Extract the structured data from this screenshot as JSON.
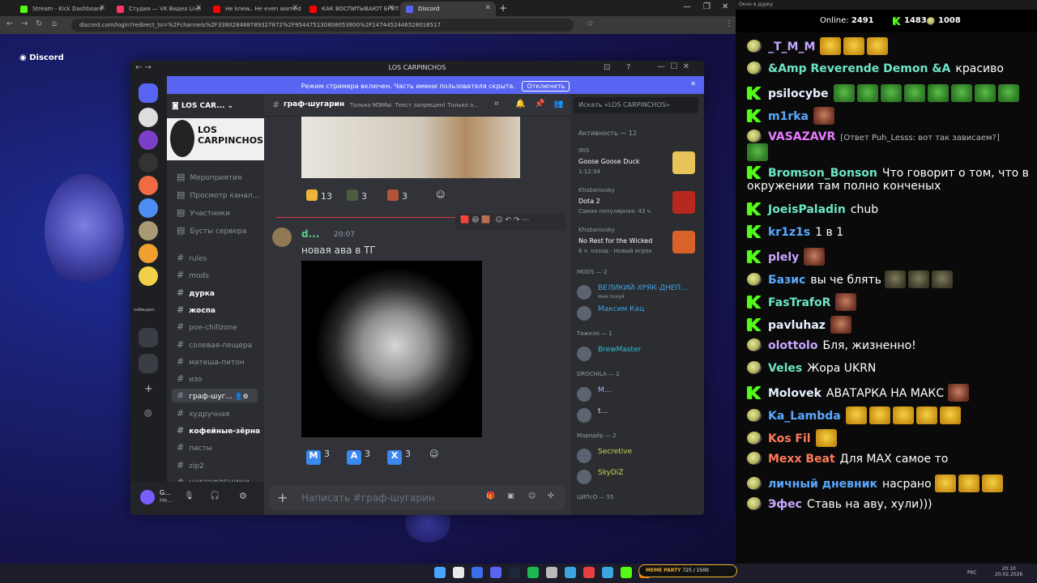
{
  "browser": {
    "tabs": [
      {
        "label": "Stream - Kick Dashboard",
        "color": "#53fc18"
      },
      {
        "label": "Студия — VK Видео Live",
        "color": "#ff3366"
      },
      {
        "label": "Не knew.. He even warned us",
        "color": "#ff0000"
      },
      {
        "label": "КАК ВОСПИТЫВАЮТ БРИТАН",
        "color": "#ff0000"
      },
      {
        "label": "Discord",
        "color": "#5865f2"
      }
    ],
    "url": "discord.com/login?redirect_to=%2Fchannels%2F338028488789327872%2F954475130808053800%2F1474452446528016517"
  },
  "discord_logo": "Discord",
  "window_title": "LOS CARPINCHOS",
  "streamer": {
    "text": "Режим стримера включен. Часть имени пользователя скрыта.",
    "button": "Отключить"
  },
  "server": {
    "name": "LOS CAR...",
    "banner": "LOS CARPINCHOS",
    "menu": [
      "Мероприятия",
      "Просмотр канал...",
      "Участники",
      "Бусты сервера"
    ],
    "channels": [
      {
        "name": "rules",
        "unread": false
      },
      {
        "name": "mods",
        "unread": false
      },
      {
        "name": "дурка",
        "unread": true
      },
      {
        "name": "жоспа",
        "unread": true
      },
      {
        "name": "poe-chillzone",
        "unread": false
      },
      {
        "name": "солевая-пещера",
        "unread": false
      },
      {
        "name": "матеша-питон",
        "unread": false
      },
      {
        "name": "изо",
        "unread": false
      },
      {
        "name": "граф-шуг...",
        "unread": false,
        "selected": true
      },
      {
        "name": "худручная",
        "unread": false
      },
      {
        "name": "кофейные-зёрна",
        "unread": true
      },
      {
        "name": "пасты",
        "unread": false
      },
      {
        "name": "zip2",
        "unread": false
      },
      {
        "name": "ШИЗОФРЕНИКИ",
        "unread": false
      }
    ],
    "sidebar_label": "хобвыдел"
  },
  "user_panel": {
    "name": "G...",
    "status": "Не..."
  },
  "channel_header": {
    "name": "граф-шугарин",
    "topic": "Только МЭМЫ. Текст запрещен! Только э...",
    "search": "Искать «LOS CARPINCHOS»"
  },
  "messages": {
    "reactions_top": [
      {
        "count": "13",
        "color": "#f0b33a"
      },
      {
        "count": "3",
        "color": "#4b5d3e"
      },
      {
        "count": "3",
        "color": "#b0553a"
      }
    ],
    "author": "d...",
    "time": "20:07",
    "text": "новая ава в ТГ",
    "reactions_bottom": [
      {
        "letter": "M",
        "count": "3"
      },
      {
        "letter": "A",
        "count": "3"
      },
      {
        "letter": "X",
        "count": "3"
      }
    ]
  },
  "composer": {
    "placeholder": "Написать #граф-шугарин"
  },
  "members": {
    "activity_header": "Активность — 12",
    "activities": [
      {
        "user": "IRIS",
        "game": "Goose Goose Duck",
        "detail": "1:12:34"
      },
      {
        "user": "Khabarovsky",
        "game": "Dota 2",
        "detail": "Самая популярная: 43 ч."
      },
      {
        "user": "Khabarovsky",
        "game": "No Rest for the Wicked",
        "detail": "6 ч. назад · Новый игрок"
      }
    ],
    "groups": [
      {
        "title": "MODS — 2",
        "members": [
          {
            "name": "ВЕЛИКИЙ-ХРЯК-ДНЕП...",
            "status": "мне похуй",
            "color": "#3ba5e0"
          },
          {
            "name": "Максим Кац",
            "status": "",
            "color": "#3ba5e0"
          }
        ]
      },
      {
        "title": "Тяжело — 1",
        "members": [
          {
            "name": "BrewMaster",
            "status": "",
            "color": "#2bc4d6"
          }
        ]
      },
      {
        "title": "DROCHILA — 2",
        "members": [
          {
            "name": "M...",
            "status": "",
            "color": "#a7b6ff"
          },
          {
            "name": "t...",
            "status": "",
            "color": "#dbdee1"
          }
        ]
      },
      {
        "title": "Мародёр — 2",
        "members": [
          {
            "name": "Secretive",
            "status": "",
            "color": "#c6d84a"
          },
          {
            "name": "SkyDiZ",
            "status": "",
            "color": "#c6d84a"
          }
        ]
      },
      {
        "title": "ЦИПсО — 55",
        "members": []
      }
    ]
  },
  "chat": {
    "header": "Окно в дурку",
    "online_label": "Online:",
    "online": "2491",
    "kick": "1483",
    "gold": "1008",
    "lines": [
      {
        "user": "_T_M_M",
        "color": "#c8a6ff",
        "text": "",
        "badge": "g",
        "emotes": [
          "yell",
          "yell",
          "yell"
        ]
      },
      {
        "user": "&Amp Reverende Demon &A",
        "color": "#6de6c5",
        "text": "красиво",
        "badge": "g",
        "emotes": []
      },
      {
        "user": "psilocybe",
        "color": "#e8f0ff",
        "text": "",
        "badge": "k",
        "emotes": [
          "pepe",
          "pepe",
          "pepe",
          "pepe",
          "pepe",
          "pepe",
          "pepe",
          "pepe"
        ]
      },
      {
        "user": "m1rka",
        "color": "#5aa9ff",
        "text": "",
        "badge": "k",
        "emotes": [
          "face"
        ]
      },
      {
        "user": "VASAZAVR",
        "color": "#e87bff",
        "text": "[Ответ Puh_Lesss: вот так зависаем?]",
        "badge": "g",
        "emotes": [
          "pepe"
        ]
      },
      {
        "user": "Bromson_Bonson",
        "color": "#6de6c5",
        "text": "Что говорит о том, что в",
        "text2": "окружении там полно конченых",
        "badge": "k",
        "emotes": []
      },
      {
        "user": "JoeisPaladin",
        "color": "#6de6c5",
        "text": "chub",
        "badge": "k",
        "emotes": []
      },
      {
        "user": "kr1z1s",
        "color": "#5aa9ff",
        "text": "1 в 1",
        "badge": "k",
        "emotes": []
      },
      {
        "user": "plely",
        "color": "#c8a6ff",
        "text": "",
        "badge": "k",
        "emotes": [
          "face"
        ]
      },
      {
        "user": "Базис",
        "color": "#5aa9ff",
        "text": "вы че блять",
        "badge": "g",
        "emotes": [
          "stone",
          "stone",
          "stone"
        ]
      },
      {
        "user": "FasTrafoR",
        "color": "#6de6c5",
        "text": "",
        "badge": "k",
        "emotes": [
          "face"
        ]
      },
      {
        "user": "pavluhaz",
        "color": "#e8f0ff",
        "text": "",
        "badge": "k",
        "emotes": [
          "face"
        ]
      },
      {
        "user": "olottolo",
        "color": "#c8a6ff",
        "text": "Бля, жизненно!",
        "badge": "g",
        "emotes": []
      },
      {
        "user": "Veles",
        "color": "#6de6c5",
        "text": "Жора UKRN",
        "badge": "g",
        "emotes": []
      },
      {
        "user": "Molovek",
        "color": "#e8f0ff",
        "text": "АВАТАРКА НА МАКС",
        "badge": "k",
        "emotes": [
          "face"
        ]
      },
      {
        "user": "Ka_Lambda",
        "color": "#5aa9ff",
        "text": "",
        "badge": "g",
        "emotes": [
          "yell",
          "yell",
          "yell",
          "yell",
          "yell"
        ]
      },
      {
        "user": "Kos Fil",
        "color": "#ff7a59",
        "text": "",
        "badge": "g",
        "emotes": [
          "yell"
        ]
      },
      {
        "user": "Mexx Beat",
        "color": "#ff7a59",
        "text": "Для MAX самое то",
        "badge": "g",
        "emotes": []
      },
      {
        "user": "личный дневник",
        "color": "#5aa9ff",
        "text": "насрано",
        "badge": "g",
        "emotes": [
          "yell",
          "yell",
          "yell"
        ]
      },
      {
        "user": "Эфес",
        "color": "#c8a6ff",
        "text": "Ставь на аву, хули)))",
        "badge": "g",
        "emotes": []
      }
    ]
  },
  "taskbar": {
    "widget": "MEME PARTY",
    "widget_progress": "725 / 1500",
    "lang": "РУС",
    "time": "20:10",
    "date": "20.02.2026"
  }
}
